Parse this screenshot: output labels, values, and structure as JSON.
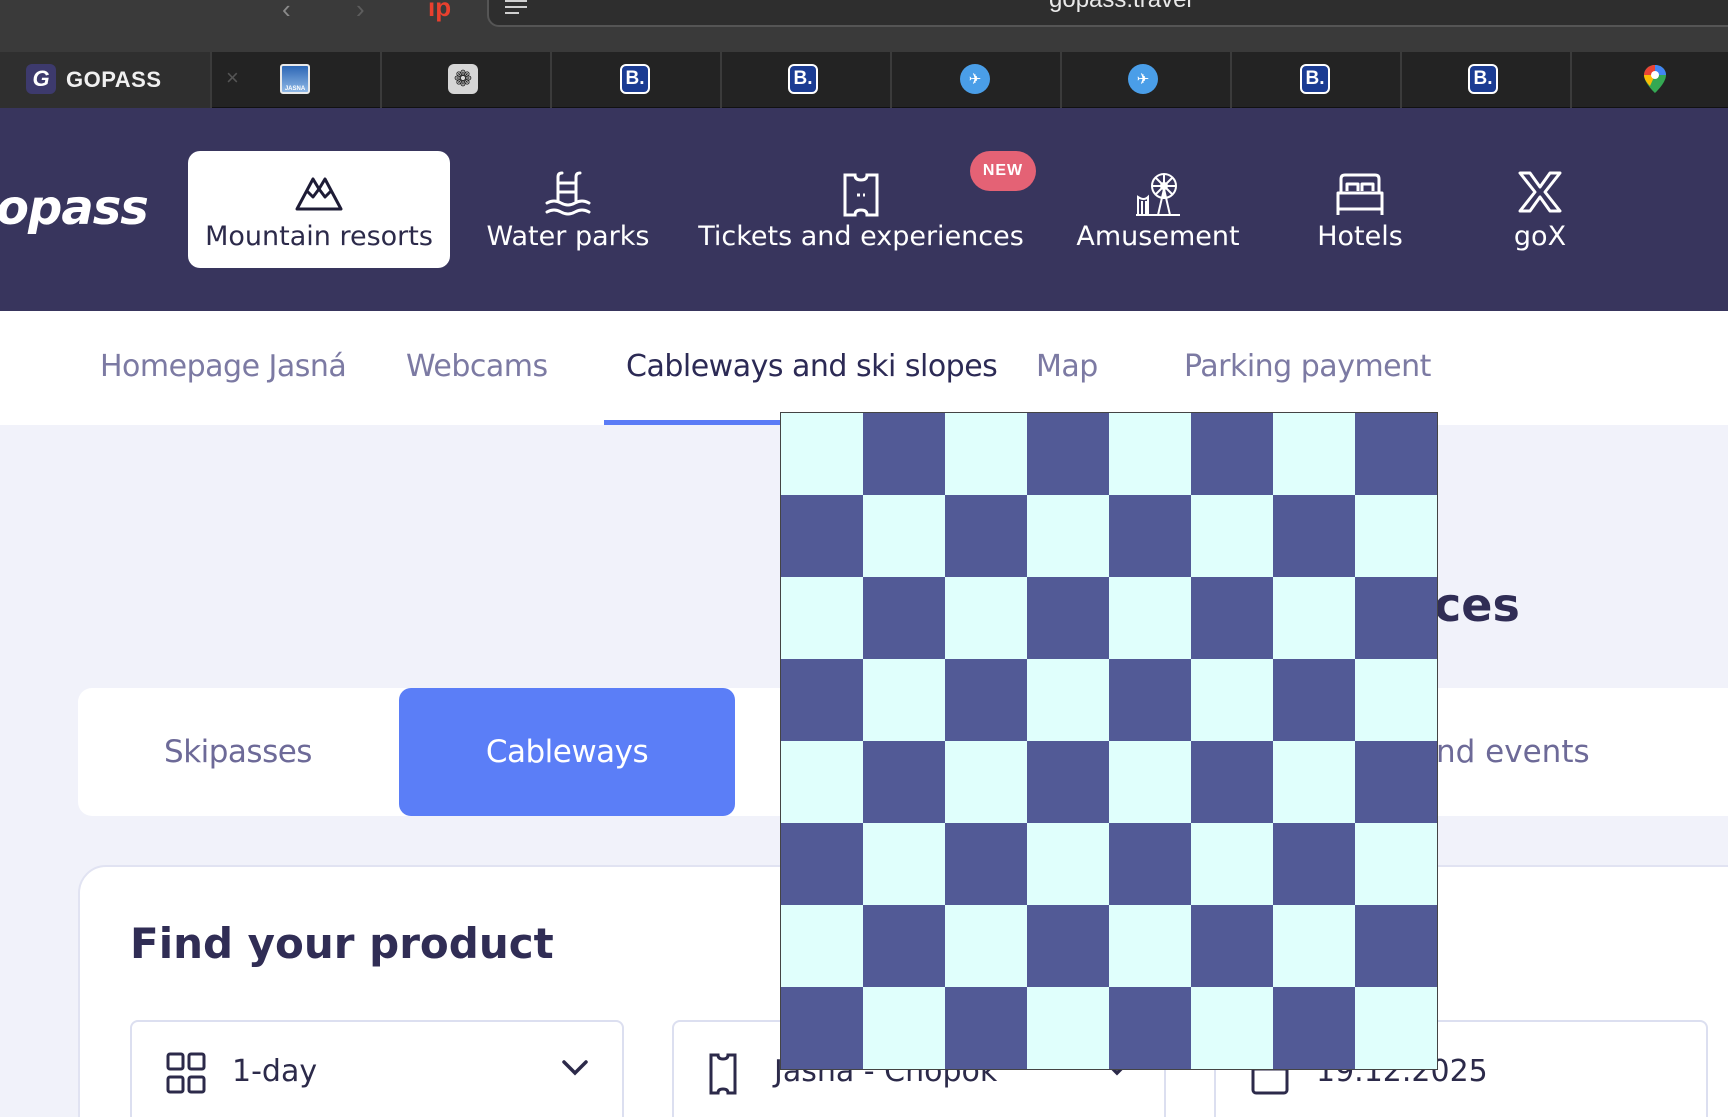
{
  "browser": {
    "url": "gopass.travel",
    "tabs": [
      {
        "title": "GOPASS",
        "favicon": "gopass-g-icon"
      },
      {
        "title": "",
        "favicon": "jasna-icon"
      },
      {
        "title": "",
        "favicon": "chatgpt-icon"
      },
      {
        "title": "",
        "favicon": "booking-icon"
      },
      {
        "title": "",
        "favicon": "booking-icon"
      },
      {
        "title": "",
        "favicon": "plane-icon"
      },
      {
        "title": "",
        "favicon": "plane-icon"
      },
      {
        "title": "",
        "favicon": "booking-icon"
      },
      {
        "title": "",
        "favicon": "booking-icon"
      },
      {
        "title": "",
        "favicon": "google-maps-icon"
      }
    ],
    "booking_glyph": "B.",
    "jasna_glyph": "JASNA",
    "gopass_glyph": "G",
    "ext_glyph": "ip"
  },
  "header": {
    "logo": "opass",
    "new_badge": "NEW",
    "categories": [
      {
        "label": "Mountain resorts",
        "icon": "mountain-icon",
        "active": true
      },
      {
        "label": "Water parks",
        "icon": "pool-icon"
      },
      {
        "label": "Tickets and experiences",
        "icon": "ticket-icon"
      },
      {
        "label": "Amusement",
        "icon": "ferris-wheel-icon"
      },
      {
        "label": "Hotels",
        "icon": "bed-icon"
      },
      {
        "label": "goX",
        "icon": "gox-icon"
      }
    ]
  },
  "subnav": {
    "items": [
      "Homepage Jasná",
      "Webcams",
      "Cableways and ski slopes",
      "Map",
      "Parking payment"
    ],
    "active_index": 2
  },
  "main": {
    "section_title_fragment": "ces",
    "segments": [
      "Skipasses",
      "Cableways"
    ],
    "segment_tail": "nd events",
    "active_segment": 1,
    "finder": {
      "title": "Find your product",
      "duration": "1-day",
      "resort": "Jasná - Chopok",
      "date": "19.12.2025"
    }
  },
  "colors": {
    "header_bg": "#38355d",
    "accent": "#5b7ef7",
    "badge": "#e46275",
    "checker_dark": "#525a96",
    "checker_light": "#e0fffc"
  }
}
